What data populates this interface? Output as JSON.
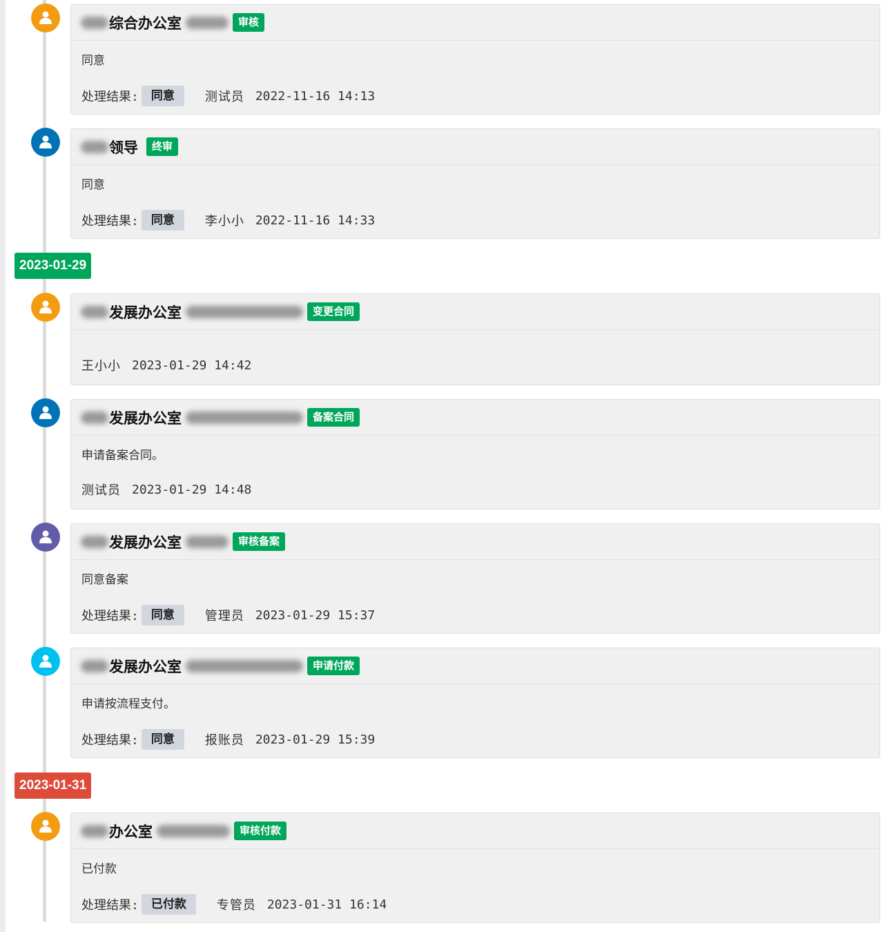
{
  "dates": [
    {
      "label": "2023-01-29",
      "color": "#00a65a"
    },
    {
      "label": "2023-01-31",
      "color": "#dd4b39"
    }
  ],
  "result_label": "处理结果:",
  "entries": [
    {
      "avatar_color": "#f39c12",
      "dept": "综合办公室",
      "tag": "审核",
      "comment": "同意",
      "has_result": true,
      "result": "同意",
      "operator": "测试员",
      "time": "2022-11-16 14:13"
    },
    {
      "avatar_color": "#0073b7",
      "dept": "领导",
      "tag": "终审",
      "comment": "同意",
      "has_result": true,
      "result": "同意",
      "operator": "李小小",
      "time": "2022-11-16 14:33"
    },
    {
      "avatar_color": "#f39c12",
      "dept": "发展办公室",
      "tag": "变更合同",
      "comment": "",
      "has_result": false,
      "result": "",
      "operator": "王小小",
      "time": "2023-01-29 14:42"
    },
    {
      "avatar_color": "#0073b7",
      "dept": "发展办公室",
      "tag": "备案合同",
      "comment": "申请备案合同。",
      "has_result": false,
      "result": "",
      "operator": "测试员",
      "time": "2023-01-29 14:48"
    },
    {
      "avatar_color": "#605ca8",
      "dept": "发展办公室",
      "tag": "审核备案",
      "comment": "同意备案",
      "has_result": true,
      "result": "同意",
      "operator": "管理员",
      "time": "2023-01-29 15:37"
    },
    {
      "avatar_color": "#00c0ef",
      "dept": "发展办公室",
      "tag": "申请付款",
      "comment": "申请按流程支付。",
      "has_result": true,
      "result": "同意",
      "operator": "报账员",
      "time": "2023-01-29 15:39"
    },
    {
      "avatar_color": "#f39c12",
      "dept": "办公室",
      "tag": "审核付款",
      "comment": "已付款",
      "has_result": true,
      "result": "已付款",
      "operator": "专管员",
      "time": "2023-01-31 16:14"
    }
  ]
}
